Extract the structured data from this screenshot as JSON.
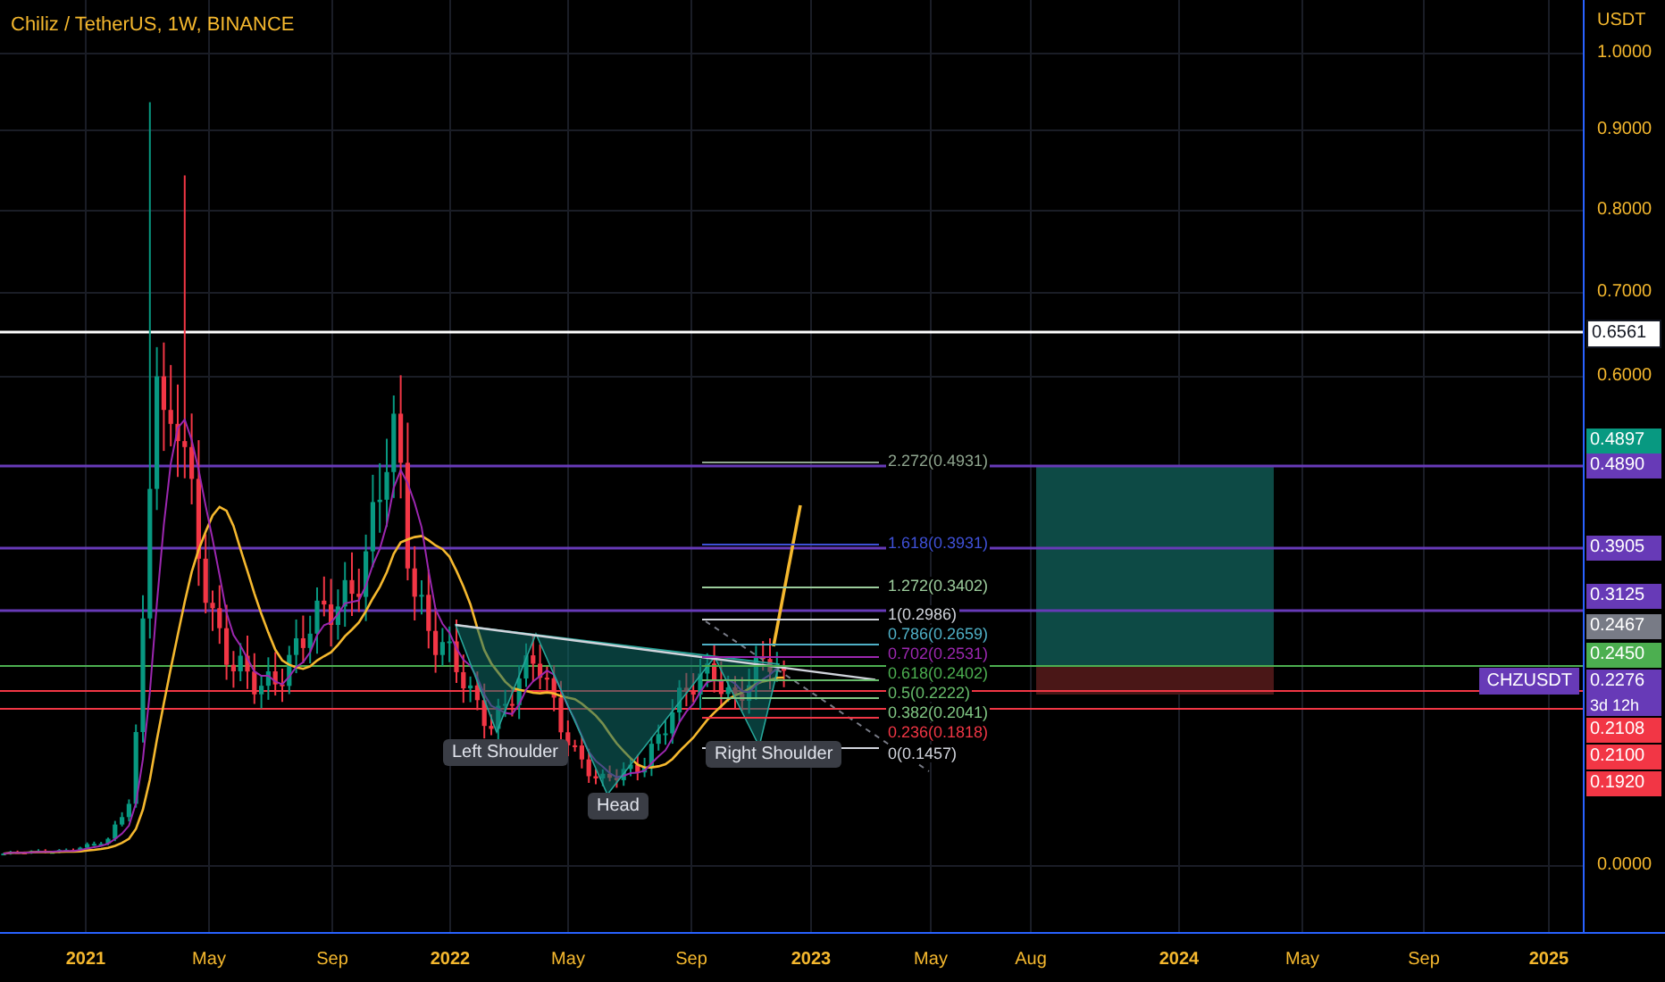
{
  "title": "Chiliz / TetherUS, 1W, BINANCE",
  "price_axis": {
    "unit": "USDT",
    "ticks": [
      "1.0000",
      "0.9000",
      "0.8000",
      "0.7000",
      "0.6000",
      "0.0000"
    ]
  },
  "price_tags": [
    {
      "text": "0.6561",
      "color": "#ffffff"
    },
    {
      "text": "0.4897",
      "color": "#089981"
    },
    {
      "text": "0.4890",
      "color": "#673ab7"
    },
    {
      "text": "0.3905",
      "color": "#673ab7"
    },
    {
      "text": "0.3125",
      "color": "#673ab7"
    },
    {
      "text": "0.2467",
      "color": "#787b86"
    },
    {
      "text": "0.2450",
      "color": "#4caf50"
    },
    {
      "text": "0.2276",
      "sub": "3d 12h",
      "color": "#673ab7"
    },
    {
      "text": "0.2108",
      "color": "#f23645"
    },
    {
      "text": "0.2100",
      "color": "#f23645"
    },
    {
      "text": "0.1920",
      "color": "#f23645"
    }
  ],
  "symbol_tag": "CHZUSDT",
  "fib_levels": [
    {
      "label": "2.272(0.4931)",
      "color": "#8fa58f"
    },
    {
      "label": "1.618(0.3931)",
      "color": "#3f51d8"
    },
    {
      "label": "1.272(0.3402)",
      "color": "#9ccc9c"
    },
    {
      "label": "1(0.2986)",
      "color": "#d1d4dc"
    },
    {
      "label": "0.786(0.2659)",
      "color": "#4fb0c6"
    },
    {
      "label": "0.702(0.2531)",
      "color": "#9c27b0"
    },
    {
      "label": "0.618(0.2402)",
      "color": "#4caf50"
    },
    {
      "label": "0.5(0.2222)",
      "color": "#66bb6a"
    },
    {
      "label": "0.382(0.2041)",
      "color": "#81c784"
    },
    {
      "label": "0.236(0.1818)",
      "color": "#f23645"
    },
    {
      "label": "0(0.1457)",
      "color": "#d1d4dc"
    }
  ],
  "pattern_labels": [
    "Left Shoulder",
    "Head",
    "Right Shoulder"
  ],
  "time_axis": [
    {
      "label": "2021",
      "kind": "year"
    },
    {
      "label": "May",
      "kind": "month"
    },
    {
      "label": "Sep",
      "kind": "month"
    },
    {
      "label": "2022",
      "kind": "year"
    },
    {
      "label": "May",
      "kind": "month"
    },
    {
      "label": "Sep",
      "kind": "month"
    },
    {
      "label": "2023",
      "kind": "year"
    },
    {
      "label": "May",
      "kind": "month"
    },
    {
      "label": "Aug",
      "kind": "month"
    },
    {
      "label": "2024",
      "kind": "year"
    },
    {
      "label": "May",
      "kind": "month"
    },
    {
      "label": "Sep",
      "kind": "month"
    },
    {
      "label": "2025",
      "kind": "year"
    }
  ]
}
